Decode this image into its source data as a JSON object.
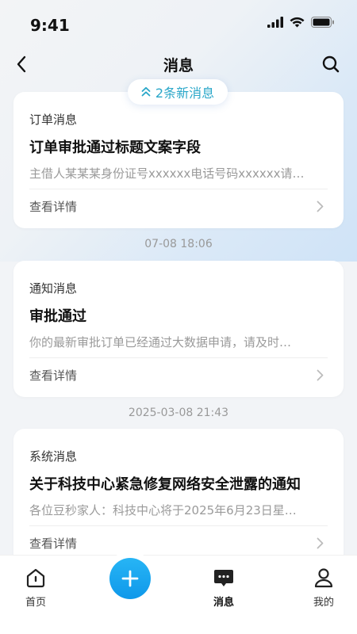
{
  "status_bar": {
    "time": "9:41"
  },
  "nav": {
    "title": "消息"
  },
  "new_messages": {
    "label": "2条新消息"
  },
  "messages": [
    {
      "category": "订单消息",
      "title": "订单审批通过标题文案字段",
      "body": "主借人某某某身份证号xxxxxx电话号码xxxxxx请…",
      "link": "查看详情"
    },
    {
      "timestamp": "07-08 18:06",
      "category": "通知消息",
      "title": "审批通过",
      "body": "你的最新审批订单已经通过大数据申请，请及时…",
      "link": "查看详情"
    },
    {
      "timestamp": "2025-03-08 21:43",
      "category": "系统消息",
      "title": "关于科技中心紧急修复网络安全泄露的通知",
      "body": "各位豆秒家人：科技中心将于2025年6月23日星…",
      "link": "查看详情"
    }
  ],
  "tabs": [
    {
      "label": "首页",
      "icon": "home-icon"
    },
    {
      "label": "消息",
      "icon": "message-icon",
      "active": true
    },
    {
      "label": "我的",
      "icon": "user-icon"
    }
  ],
  "colors": {
    "accent": "#2aa7c9",
    "fab": "#1aa3ee"
  }
}
